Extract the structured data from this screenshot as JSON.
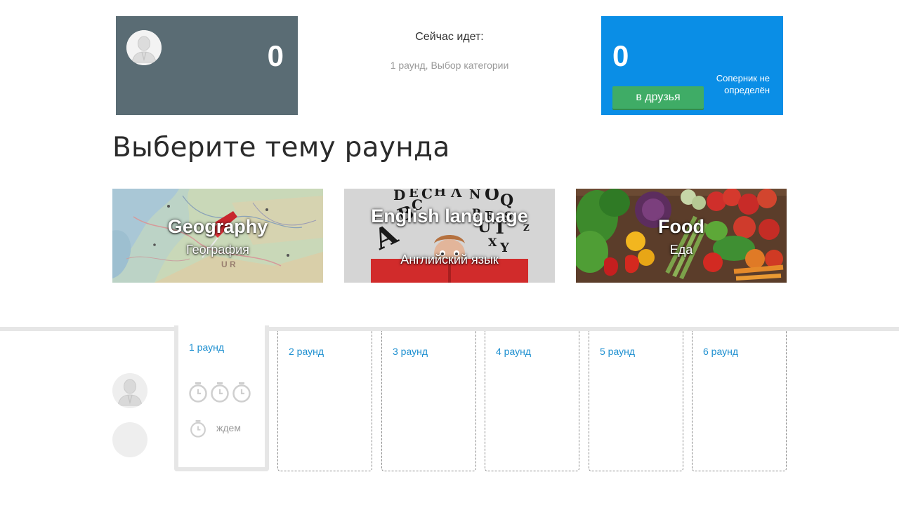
{
  "player": {
    "score": "0",
    "avatar_icon": "user-silhouette-icon"
  },
  "status": {
    "label": "Сейчас идет:",
    "round_state": "1 раунд, Выбор категории"
  },
  "opponent": {
    "score": "0",
    "friend_button": "в друзья",
    "status": "Соперник не определён"
  },
  "heading": "Выберите тему раунда",
  "categories": [
    {
      "title": "Geography",
      "subtitle": "География",
      "image": "map-pin-image"
    },
    {
      "title": "English language",
      "subtitle": "Английский язык",
      "image": "letters-reader-image"
    },
    {
      "title": "Food",
      "subtitle": "Еда",
      "image": "vegetables-image"
    }
  ],
  "rounds": [
    {
      "label": "1 раунд",
      "active": true
    },
    {
      "label": "2 раунд"
    },
    {
      "label": "3 раунд"
    },
    {
      "label": "4 раунд"
    },
    {
      "label": "5 раунд"
    },
    {
      "label": "6 раунд"
    }
  ],
  "waiting_label": "ждем",
  "colors": {
    "player_panel": "#5a6c74",
    "opponent_panel": "#0a8ee6",
    "friend_button": "#3fac66",
    "round_link": "#1d8fd0"
  }
}
